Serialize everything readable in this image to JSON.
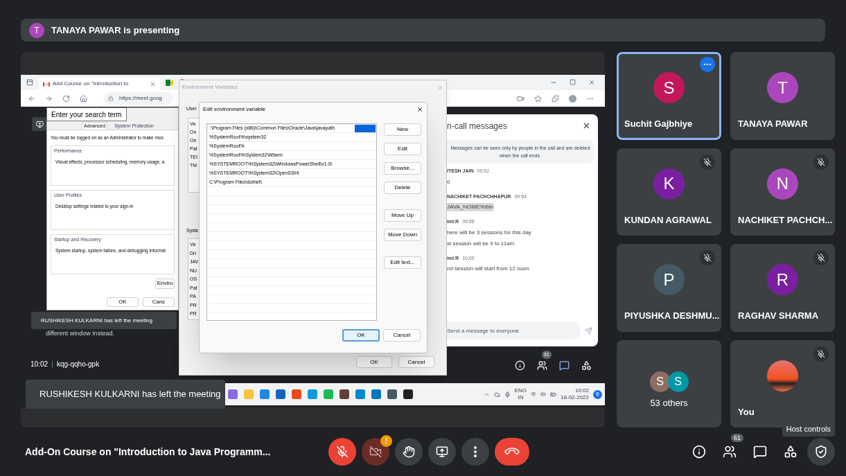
{
  "banner": {
    "initial": "T",
    "text": "TANAYA PAWAR is presenting"
  },
  "shared_screen": {
    "browser": {
      "tab_title": "Add Course on \"Introduction to",
      "address": "https://meet.goog"
    },
    "search_tooltip": "Enter your search term",
    "system_properties": {
      "tabs": [
        {
          "label": "Advanced",
          "selected": true
        },
        {
          "label": "System Protection",
          "selected": false
        }
      ],
      "notice": "You must be logged on as an Administrator to make mos",
      "sections": [
        {
          "title": "Performance",
          "text": "Visual effects, processor scheduling, memory usage, a"
        },
        {
          "title": "User Profiles",
          "text": "Desktop settings related to your sign-in"
        },
        {
          "title": "Startup and Recovery",
          "text": "System startup, system failure, and debugging informat"
        }
      ],
      "env_button": "Enviro",
      "buttons": [
        "OK",
        "Canc"
      ]
    },
    "environment_variables": {
      "title": "Environment Variables",
      "user_label": "User",
      "user_rows": [
        "Va",
        "On",
        "On",
        "Pat",
        "TEI",
        "TM"
      ],
      "system_label": "Syste",
      "system_rows": [
        "Va",
        "Dri",
        "JAV",
        "NU",
        "OS",
        "Pat",
        "PA",
        "PR",
        "PR"
      ],
      "buttons": [
        "OK",
        "Cancel"
      ]
    },
    "edit_dialog": {
      "title": "Edit environment variable",
      "entries": [
        {
          "text": ":\\Program Files (x86)\\Common Files\\Oracle\\Java\\javapath",
          "selected": true
        },
        {
          "text": "%SystemRoot%\\system32",
          "selected": false
        },
        {
          "text": "%SystemRoot%",
          "selected": false
        },
        {
          "text": "%SystemRoot%\\System32\\Wbem",
          "selected": false
        },
        {
          "text": "%SYSTEMROOT%\\System32\\WindowsPowerShell\\v1.0\\",
          "selected": false
        },
        {
          "text": "%SYSTEMROOT%\\System32\\OpenSSH\\",
          "selected": false
        },
        {
          "text": "C:\\Program Files\\dotnet\\",
          "selected": false
        }
      ],
      "side_button_groups": [
        [
          "New",
          "Edit",
          "Browse...",
          "Delete"
        ],
        [
          "Move Up",
          "Move Down"
        ],
        [
          "Edit text..."
        ]
      ],
      "buttons": [
        {
          "label": "OK",
          "focused": true
        },
        {
          "label": "Cancel",
          "focused": false
        }
      ]
    },
    "chat": {
      "title": "n-call messages",
      "notice": "Messages can be seen only by people in the call and are deleted when the call ends.",
      "messages": [
        {
          "sender": "ITESH JAIN",
          "time": "09:52",
          "lines": [
            "0"
          ],
          "highlighted": false
        },
        {
          "sender": "NACHIKET PACHCHHAPUR",
          "time": "09:54",
          "lines": [
            "JAVA_HOME%\\bin"
          ],
          "highlighted": true
        },
        {
          "sender": "imi R",
          "time": "09:58",
          "lines": [
            "here will be 3 sessions for this day",
            "st session will be 9 to 11am"
          ],
          "highlighted": false
        },
        {
          "sender": "imi R",
          "time": "10:00",
          "lines": [
            "nd session will start from 12 noon"
          ],
          "highlighted": false
        }
      ],
      "placeholder": "Send a message to everyone"
    },
    "inner_toast": {
      "text": "RUSHIKESH KULKARNI has left the meeting",
      "subtext": "different window instead."
    },
    "inner_bar": {
      "time": "10:02",
      "code": "kqg-qqho-gpk",
      "buttons": [
        {
          "kind": "info",
          "selected": false
        },
        {
          "kind": "people",
          "badge": "61",
          "selected": false
        },
        {
          "kind": "chat",
          "selected": true
        },
        {
          "kind": "activities",
          "selected": false
        }
      ]
    },
    "taskbar": {
      "language": "ENG",
      "region": "IN",
      "time": "10:02",
      "date": "18-02-2022",
      "notifications": "6"
    }
  },
  "toast": "RUSHIKESH KULKARNI has left the meeting",
  "participants": [
    {
      "kind": "person",
      "initial": "S",
      "name": "Suchit Gajbhiye",
      "color": "#c2185b",
      "muted": false,
      "highlighted": true
    },
    {
      "kind": "person",
      "initial": "T",
      "name": "TANAYA PAWAR",
      "color": "#ab47bc",
      "muted": false,
      "highlighted": false
    },
    {
      "kind": "person",
      "initial": "K",
      "name": "KUNDAN AGRAWAL",
      "color": "#7b1fa2",
      "muted": true,
      "highlighted": false
    },
    {
      "kind": "person",
      "initial": "N",
      "name": "NACHIKET PACHCH...",
      "color": "#ab47bc",
      "muted": true,
      "highlighted": false
    },
    {
      "kind": "person",
      "initial": "P",
      "name": "PIYUSHKA DESHMU...",
      "color": "#455a64",
      "muted": true,
      "highlighted": false
    },
    {
      "kind": "person",
      "initial": "R",
      "name": "RAGHAV SHARMA",
      "color": "#7b1fa2",
      "muted": true,
      "highlighted": false
    },
    {
      "kind": "group",
      "avatars": [
        {
          "initial": "S",
          "color": "#8d6e63"
        },
        {
          "initial": "S",
          "color": "#0097a7"
        }
      ],
      "name": "53 others",
      "muted": false,
      "highlighted": false
    },
    {
      "kind": "self",
      "name": "You",
      "muted": true,
      "highlighted": false
    }
  ],
  "host_controls_tooltip": "Host controls",
  "meeting_title": "Add-On Course on \"Introduction to Java Programm...",
  "controls": [
    {
      "kind": "mic",
      "on": false
    },
    {
      "kind": "camera",
      "on": false,
      "badge": "!"
    },
    {
      "kind": "raise_hand"
    },
    {
      "kind": "present"
    },
    {
      "kind": "more"
    },
    {
      "kind": "end_call"
    }
  ],
  "side_controls": [
    {
      "kind": "info"
    },
    {
      "kind": "people",
      "badge": "61"
    },
    {
      "kind": "chat"
    },
    {
      "kind": "activities"
    },
    {
      "kind": "host_controls"
    }
  ]
}
